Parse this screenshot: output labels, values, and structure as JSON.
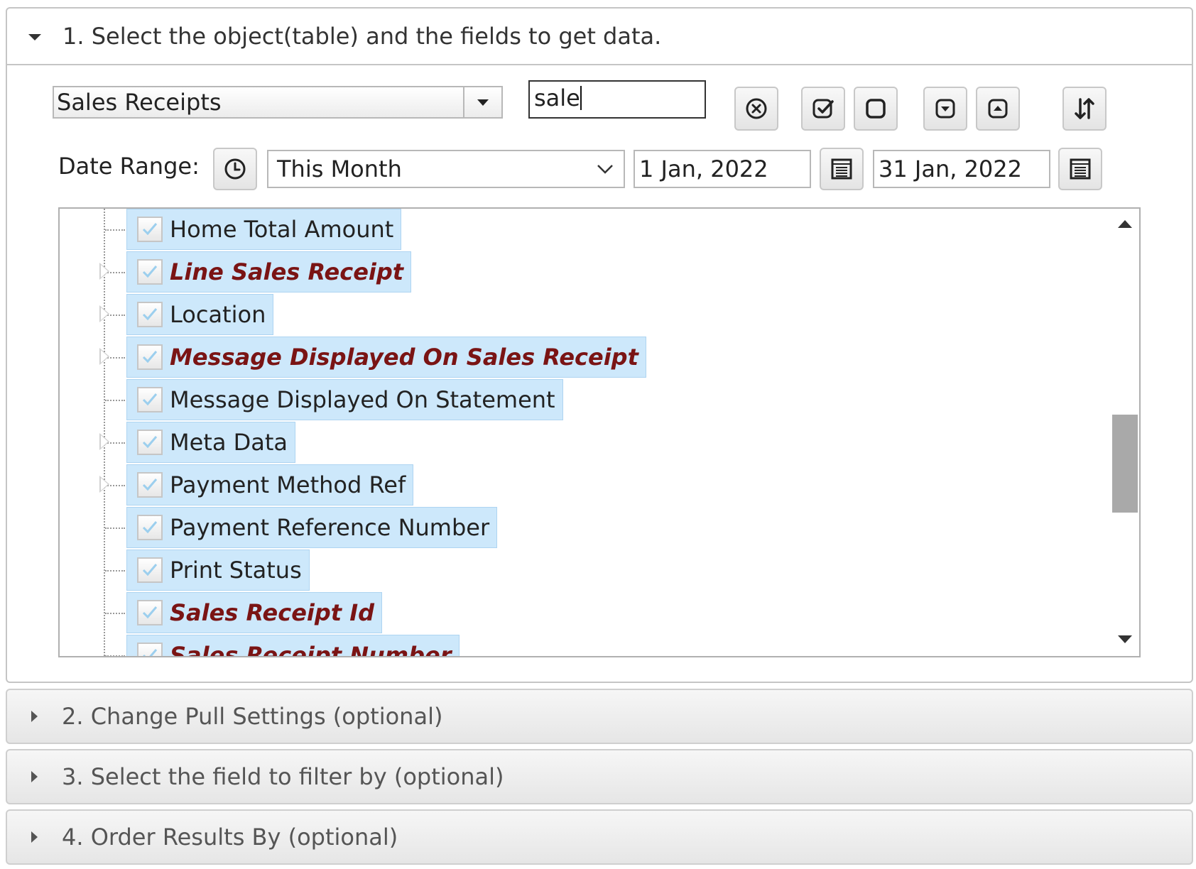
{
  "section1": {
    "title": "1. Select the object(table) and the fields to get data.",
    "object_select": {
      "value": "Sales Receipts"
    },
    "search": {
      "value": "sale"
    },
    "toolbar": {
      "clear_icon": "circle-x-icon",
      "check_all_icon": "check-square-icon",
      "uncheck_all_icon": "empty-square-icon",
      "expand_icon": "expand-down-icon",
      "collapse_icon": "collapse-up-icon",
      "sort_icon": "sort-arrows-icon"
    },
    "date_range": {
      "label": "Date Range:",
      "preset": "This Month",
      "from": "1 Jan, 2022",
      "to": "31 Jan, 2022"
    },
    "tree": {
      "items": [
        {
          "label": "Home Total Amount",
          "checked": true,
          "key": false,
          "expandable": false
        },
        {
          "label": "Line Sales Receipt",
          "checked": true,
          "key": true,
          "expandable": true
        },
        {
          "label": "Location",
          "checked": true,
          "key": false,
          "expandable": true
        },
        {
          "label": "Message Displayed On Sales Receipt",
          "checked": true,
          "key": true,
          "expandable": true
        },
        {
          "label": "Message Displayed On Statement",
          "checked": true,
          "key": false,
          "expandable": false
        },
        {
          "label": "Meta Data",
          "checked": true,
          "key": false,
          "expandable": true
        },
        {
          "label": "Payment Method Ref",
          "checked": true,
          "key": false,
          "expandable": true
        },
        {
          "label": "Payment Reference Number",
          "checked": true,
          "key": false,
          "expandable": false
        },
        {
          "label": "Print Status",
          "checked": true,
          "key": false,
          "expandable": false
        },
        {
          "label": "Sales Receipt Id",
          "checked": true,
          "key": true,
          "expandable": false
        },
        {
          "label": "Sales Receipt Number",
          "checked": true,
          "key": true,
          "expandable": false
        }
      ]
    }
  },
  "section2": {
    "title": "2. Change Pull Settings (optional)"
  },
  "section3": {
    "title": "3. Select the field to filter by (optional)"
  },
  "section4": {
    "title": "4. Order Results By (optional)"
  },
  "colors": {
    "node_bg": "#cde8fb",
    "key_field_text": "#7a1414"
  }
}
